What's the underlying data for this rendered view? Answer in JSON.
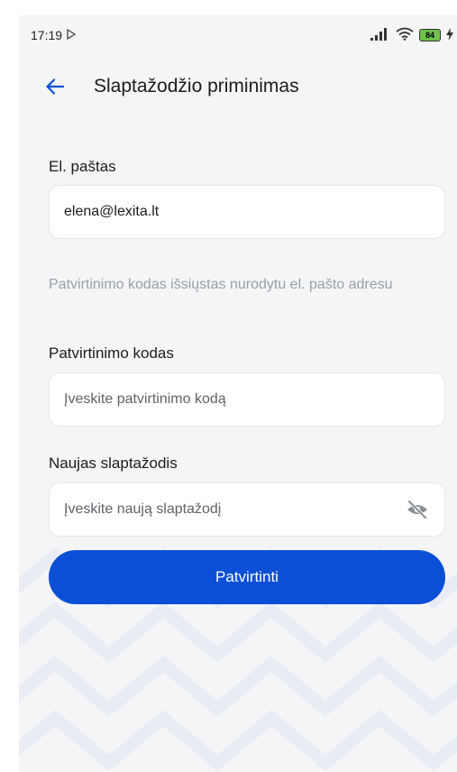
{
  "status_bar": {
    "time": "17:19",
    "battery": "84",
    "signal_icon": "signal-icon",
    "wifi_icon": "wifi-icon"
  },
  "header": {
    "title": "Slaptažodžio priminimas",
    "back_icon": "arrow-left-icon"
  },
  "form": {
    "email_label": "El. paštas",
    "email_value": "elena@lexita.lt",
    "hint": "Patvirtinimo kodas išsiųstas nurodytu el. pašto adresu",
    "code_label": "Patvirtinimo kodas",
    "code_placeholder": "Įveskite patvirtinimo kodą",
    "password_label": "Naujas slaptažodis",
    "password_placeholder": "Įveskite naują slaptažodį",
    "submit_label": "Patvirtinti"
  },
  "colors": {
    "accent": "#0a4fd6",
    "background": "#f4f5f7",
    "hint": "#9aa0a6"
  }
}
